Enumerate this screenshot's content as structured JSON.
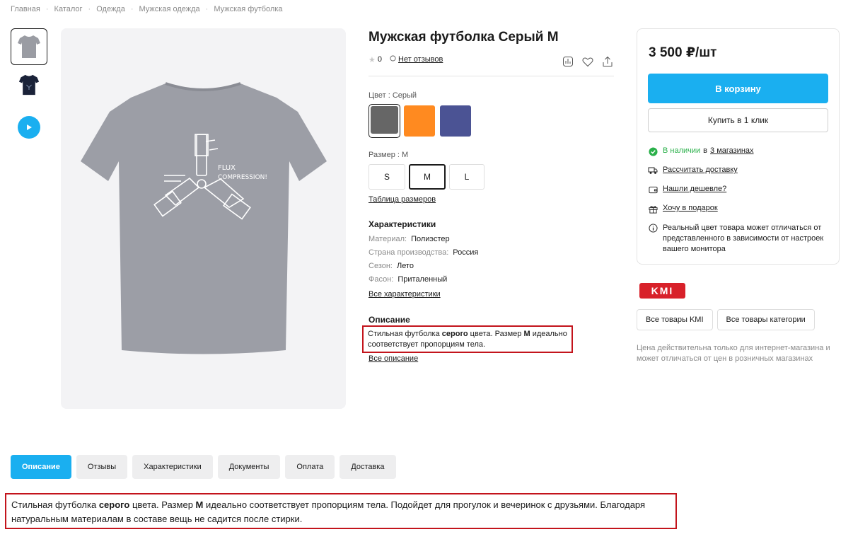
{
  "breadcrumb": [
    "Главная",
    "Каталог",
    "Одежда",
    "Мужская одежда",
    "Мужская футболка"
  ],
  "product": {
    "title": "Мужская футболка Серый M",
    "rating": "0",
    "reviews_link": "Нет отзывов"
  },
  "gallery": {
    "thumb_colors": [
      "#9a9ca3",
      "#1a2238"
    ],
    "main_tshirt_color": "#9c9ea6",
    "print_text_1": "FLUX",
    "print_text_2": "COMPRESSION!"
  },
  "color": {
    "label": "Цвет : Серый",
    "swatches": [
      {
        "name": "gray",
        "hex": "#666666"
      },
      {
        "name": "orange",
        "hex": "#ff8a20"
      },
      {
        "name": "blue",
        "hex": "#4b5394"
      }
    ]
  },
  "size": {
    "label": "Размер : M",
    "options": [
      "S",
      "M",
      "L"
    ],
    "selected": "M",
    "table_link": "Таблица размеров"
  },
  "specs": {
    "heading": "Характеристики",
    "items": [
      {
        "key": "Материал:",
        "value": "Полиэстер"
      },
      {
        "key": "Страна производства:",
        "value": "Россия"
      },
      {
        "key": "Сезон:",
        "value": "Лето"
      },
      {
        "key": "Фасон:",
        "value": "Приталенный"
      }
    ],
    "all_link": "Все характеристики"
  },
  "description": {
    "heading": "Описание",
    "short_pre": "Стильная футболка ",
    "short_bold1": "серого",
    "short_mid": " цвета. Размер ",
    "short_bold2": "M",
    "short_post": " идеально соответствует пропорциям тела.",
    "all_link": "Все описание",
    "full_pre": "Стильная футболка ",
    "full_bold1": "серого",
    "full_mid": " цвета. Размер ",
    "full_bold2": "M",
    "full_post": " идеально соответствует пропорциям тела. Подойдет для прогулок и вечеринок с друзьями. Благодаря натуральным материалам в составе вещь не садится после стирки."
  },
  "buy": {
    "price": "3 500 ₽/шт",
    "cart_label": "В корзину",
    "one_click_label": "Купить в 1 клик",
    "stock_status": "В наличии",
    "stock_in": "в",
    "stock_link": "3 магазинах",
    "delivery": "Рассчитать доставку",
    "cheaper": "Нашли дешевле?",
    "gift": "Хочу в подарок",
    "color_note": "Реальный цвет товара может отличаться от представленного в зависимости от настроек вашего монитора"
  },
  "brand": {
    "logo_text": "KMI",
    "all_brand_label": "Все товары KMI",
    "all_category_label": "Все товары категории",
    "price_note": "Цена действительна только для интернет-магазина и может отличаться от цен в розничных магазинах"
  },
  "tabs": [
    "Описание",
    "Отзывы",
    "Характеристики",
    "Документы",
    "Оплата",
    "Доставка"
  ],
  "colors": {
    "accent": "#1aaff0",
    "highlight_border": "#c3141c",
    "in_stock": "#2ab04a"
  }
}
